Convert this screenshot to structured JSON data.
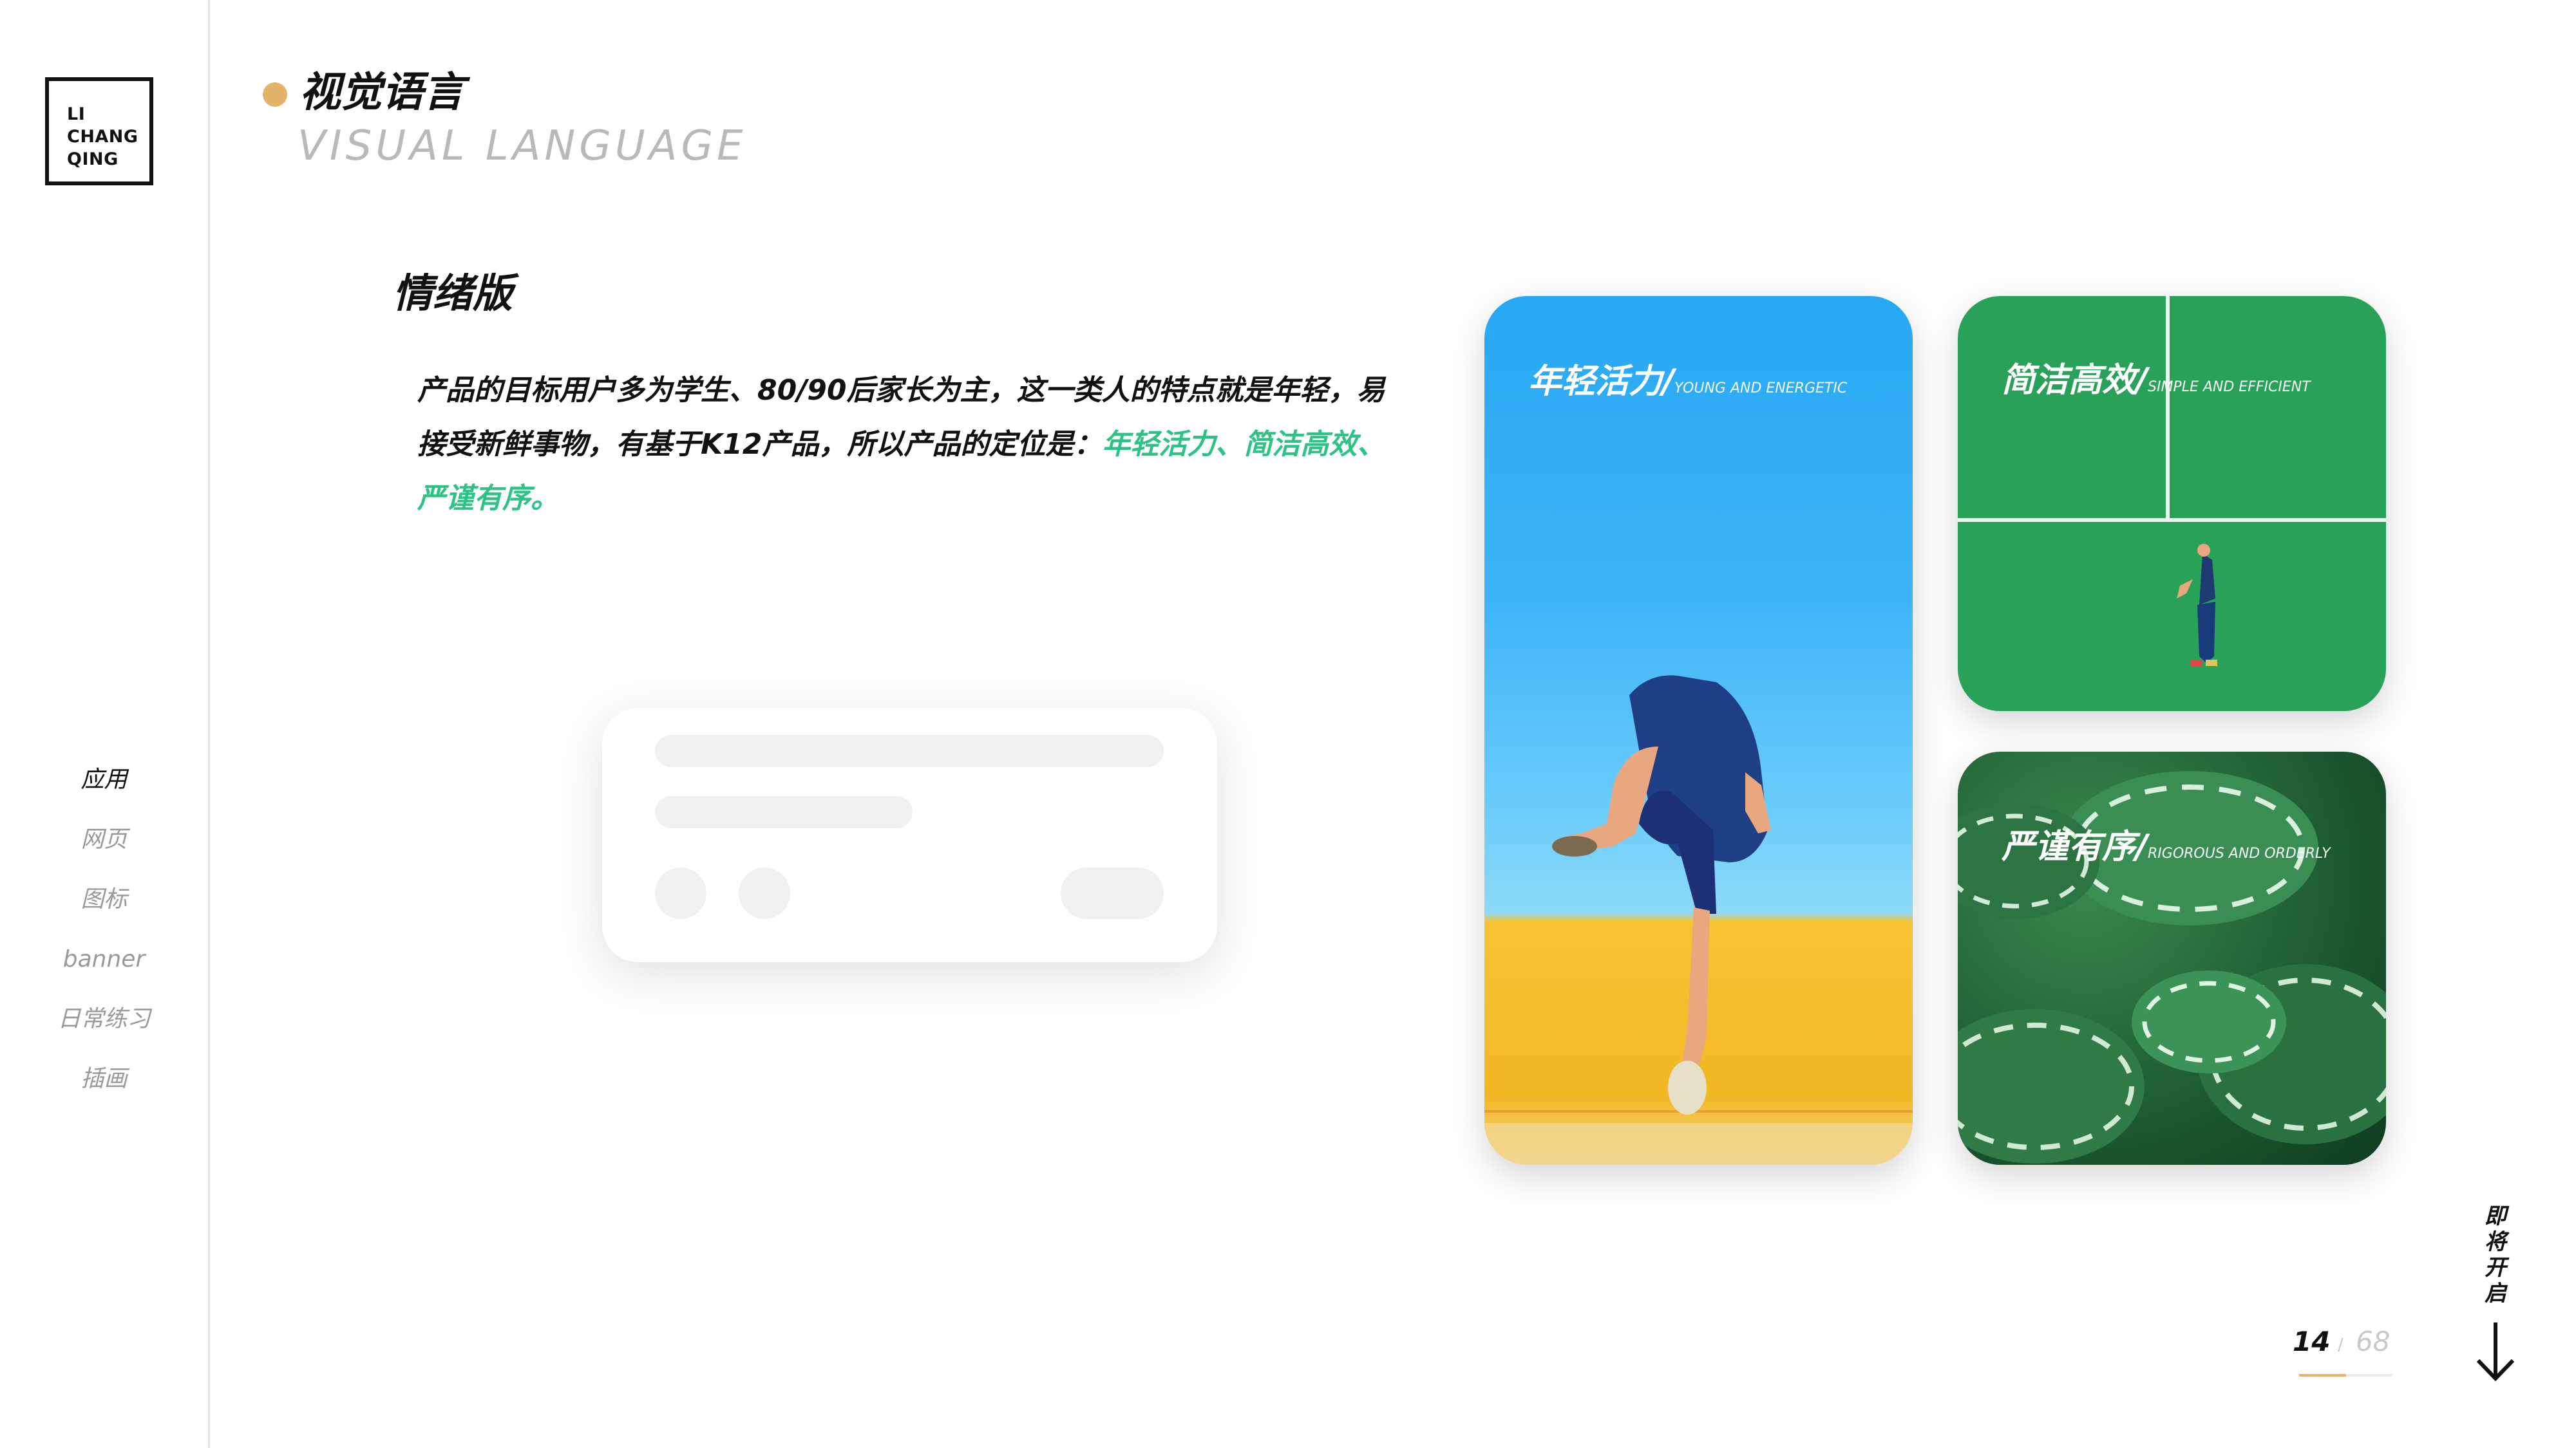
{
  "logo": {
    "lines": [
      "LI",
      "CHANG",
      "QING"
    ]
  },
  "nav": {
    "items": [
      {
        "label": "应用",
        "active": true
      },
      {
        "label": "网页",
        "active": false
      },
      {
        "label": "图标",
        "active": false
      },
      {
        "label": "banner",
        "active": false
      },
      {
        "label": "日常练习",
        "active": false
      },
      {
        "label": "插画",
        "active": false
      }
    ]
  },
  "header": {
    "title_cn": "视觉语言",
    "title_en": "VISUAL LANGUAGE"
  },
  "section": {
    "title": "情绪版",
    "description_part1": "产品的目标用户多为学生、80/90后家长为主，这一类人的特点就是年轻，易接受新鲜事物，有基于K12产品，所以产品的定位是：",
    "description_highlight": "年轻活力、简洁高效、严谨有序。"
  },
  "mood_cards": [
    {
      "label_cn": "年轻活力/",
      "label_en": "YOUNG AND ENERGETIC"
    },
    {
      "label_cn": "简洁高效/",
      "label_en": "SIMPLE AND EFFICIENT"
    },
    {
      "label_cn": "严谨有序/",
      "label_en": "RIGOROUS AND ORDERLY"
    }
  ],
  "pagination": {
    "current": "14",
    "separator": "/",
    "total": "68",
    "progress": 0.5
  },
  "coming_soon": {
    "chars": [
      "即",
      "将",
      "开",
      "启"
    ]
  },
  "colors": {
    "accent_gold": "#e3b46a",
    "accent_green": "#2ec285"
  },
  "icons": {
    "scroll": "arrow-down-icon"
  }
}
